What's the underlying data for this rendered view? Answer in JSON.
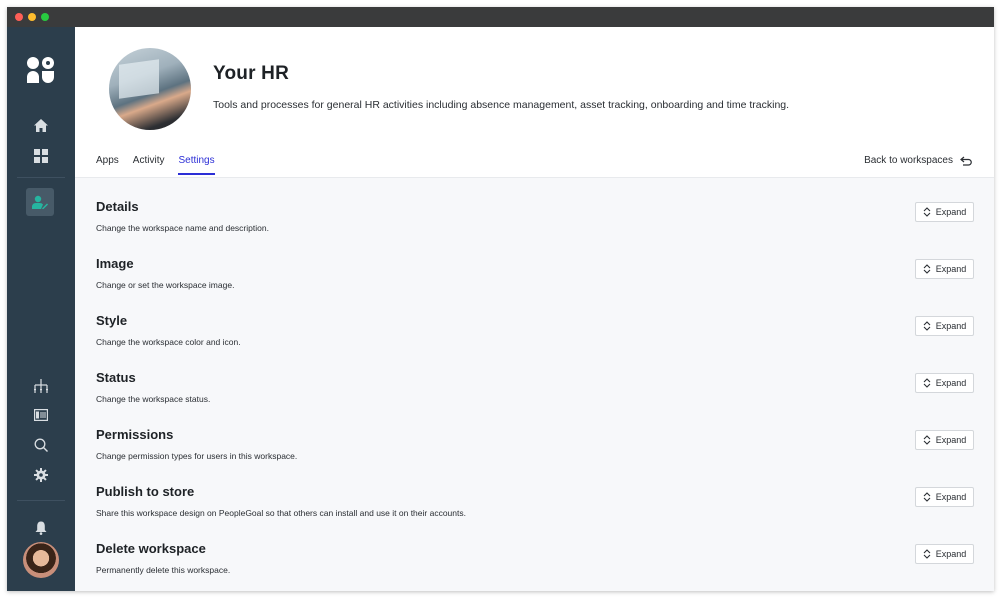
{
  "window": {
    "controls": [
      "close",
      "minimize",
      "maximize"
    ]
  },
  "sidebar": {
    "logo": "peoplegoal-logo",
    "top_items": [
      {
        "name": "home",
        "icon": "home-icon"
      },
      {
        "name": "apps",
        "icon": "grid-icon"
      }
    ],
    "active_item": {
      "name": "user-settings",
      "icon": "user-edit-icon",
      "color": "#26b5a0"
    },
    "bottom_items": [
      {
        "name": "org-chart",
        "icon": "org-chart-icon"
      },
      {
        "name": "table",
        "icon": "table-icon"
      },
      {
        "name": "search",
        "icon": "search-icon"
      },
      {
        "name": "settings",
        "icon": "gear-icon"
      }
    ],
    "notifications": {
      "icon": "bell-icon"
    },
    "avatar": "user-avatar"
  },
  "workspace": {
    "title": "Your HR",
    "description": "Tools and processes for general HR activities including absence management, asset tracking, onboarding and time tracking."
  },
  "tabs": [
    {
      "label": "Apps",
      "active": false
    },
    {
      "label": "Activity",
      "active": false
    },
    {
      "label": "Settings",
      "active": true
    }
  ],
  "back_link": {
    "label": "Back to workspaces",
    "icon": "return-arrow-icon"
  },
  "accent_color": "#2c2fd6",
  "sections": [
    {
      "title": "Details",
      "description": "Change the workspace name and description.",
      "button": "Expand"
    },
    {
      "title": "Image",
      "description": "Change or set the workspace image.",
      "button": "Expand"
    },
    {
      "title": "Style",
      "description": "Change the workspace color and icon.",
      "button": "Expand"
    },
    {
      "title": "Status",
      "description": "Change the workspace status.",
      "button": "Expand"
    },
    {
      "title": "Permissions",
      "description": "Change permission types for users in this workspace.",
      "button": "Expand"
    },
    {
      "title": "Publish to store",
      "description": "Share this workspace design on PeopleGoal so that others can install and use it on their accounts.",
      "button": "Expand"
    },
    {
      "title": "Delete workspace",
      "description": "Permanently delete this workspace.",
      "button": "Expand"
    }
  ]
}
